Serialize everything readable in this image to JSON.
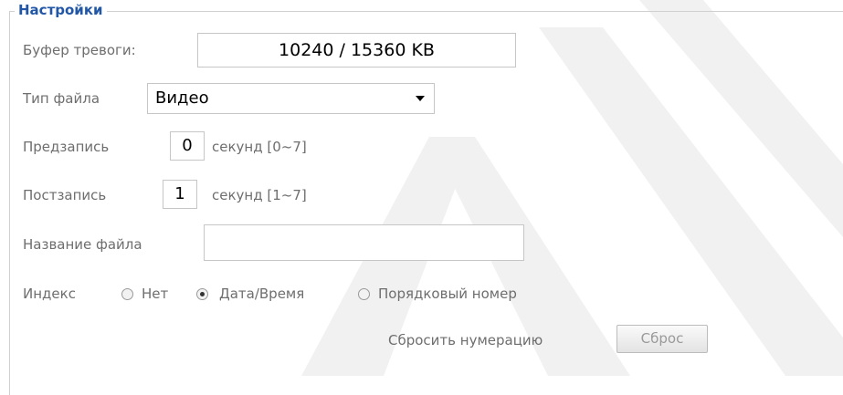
{
  "settings": {
    "title": "Настройки",
    "buffer": {
      "label": "Буфер тревоги:",
      "value": "10240 / 15360 KB"
    },
    "file_type": {
      "label": "Тип файла",
      "selected": "Видео"
    },
    "prerecord": {
      "label": "Предзапись",
      "value": "0",
      "unit": "секунд [0~7]"
    },
    "postrecord": {
      "label": "Постзапись",
      "value": "1",
      "unit": "секунд [1~7]"
    },
    "file_name": {
      "label": "Название файла",
      "value": ""
    },
    "index": {
      "label": "Индекс",
      "options": [
        "Нет",
        "Дата/Время",
        "Порядковый номер"
      ],
      "selected": "Дата/Время"
    },
    "reset": {
      "label": "Сбросить нумерацию",
      "button": "Сброс"
    }
  }
}
